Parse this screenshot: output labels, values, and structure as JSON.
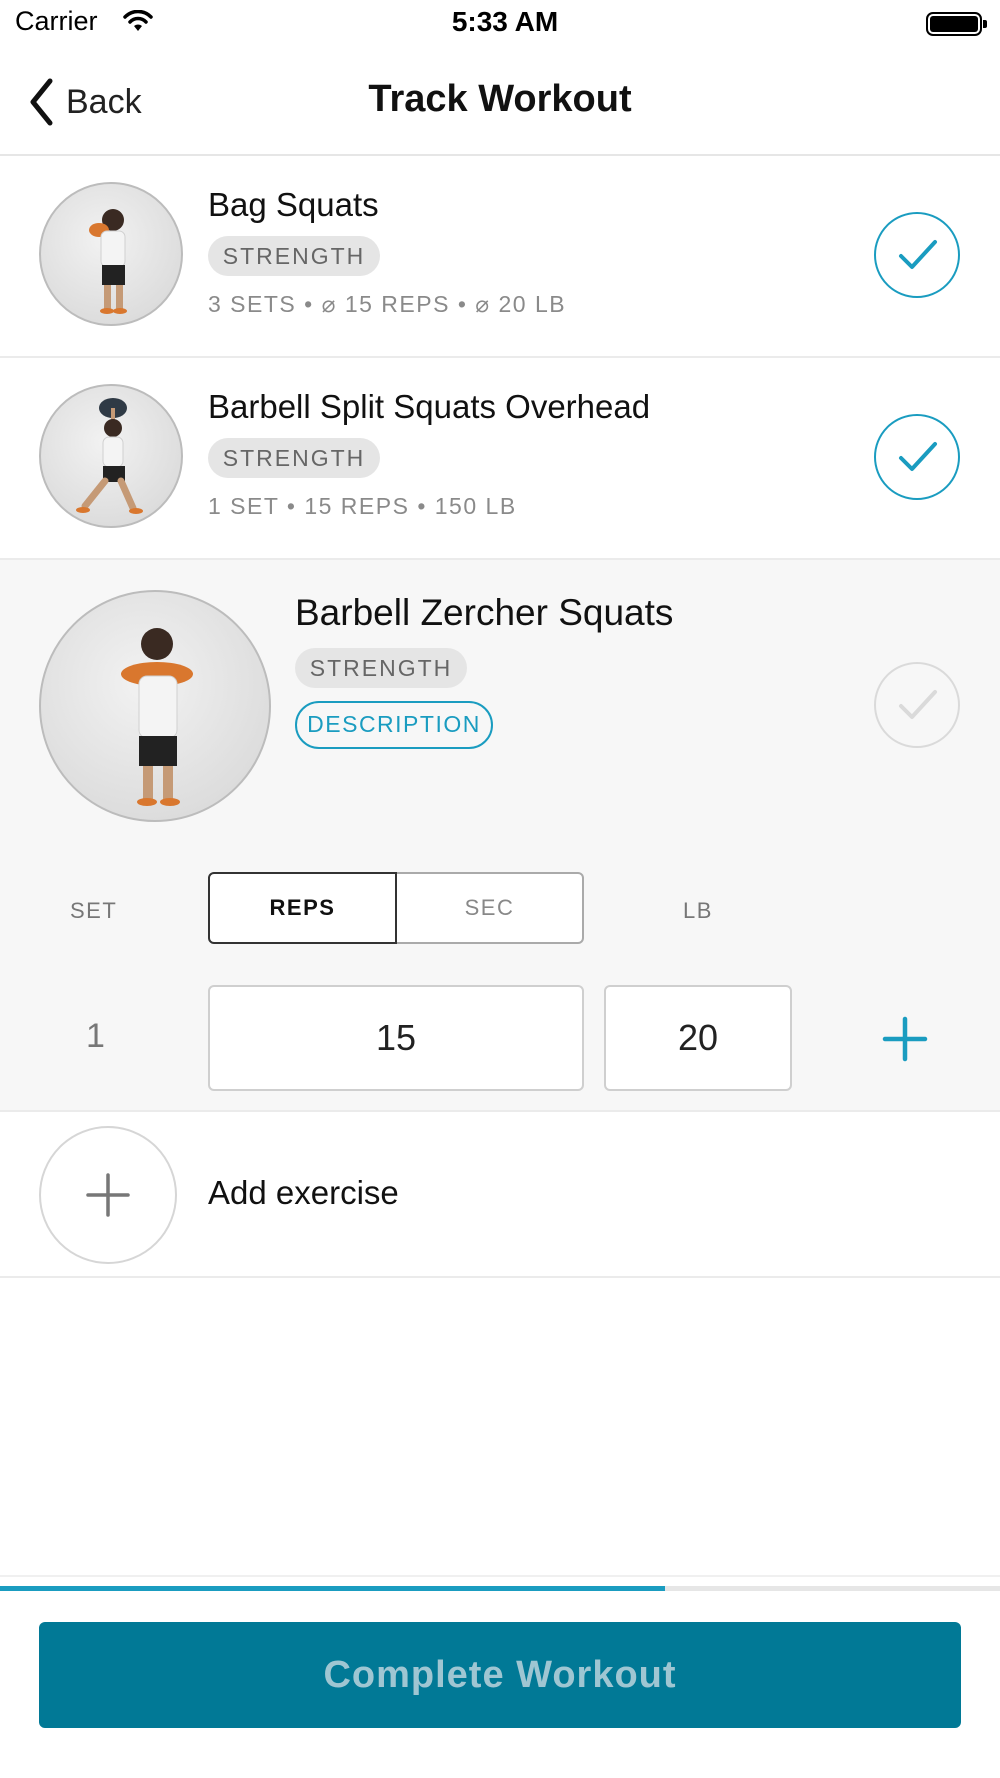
{
  "status_bar": {
    "carrier": "Carrier",
    "time": "5:33 AM"
  },
  "nav": {
    "back_label": "Back",
    "title": "Track Workout"
  },
  "exercises": [
    {
      "name": "Bag Squats",
      "tag": "STRENGTH",
      "meta": "3 SETS • ⌀ 15 REPS • ⌀ 20 LB",
      "completed": true
    },
    {
      "name": "Barbell Split Squats Overhead",
      "tag": "STRENGTH",
      "meta": "1 SET • 15 REPS • 150 LB",
      "completed": true
    },
    {
      "name": "Barbell Zercher Squats",
      "tag": "STRENGTH",
      "description_label": "DESCRIPTION",
      "completed": false
    }
  ],
  "sets_table": {
    "set_header": "SET",
    "reps_tab": "REPS",
    "sec_tab": "SEC",
    "weight_header": "LB",
    "rows": [
      {
        "set": "1",
        "reps": "15",
        "weight": "20"
      }
    ]
  },
  "add_exercise_label": "Add exercise",
  "progress": 0.665,
  "complete_button": "Complete Workout",
  "colors": {
    "accent": "#1a9cc0",
    "button_bg": "#017996"
  }
}
